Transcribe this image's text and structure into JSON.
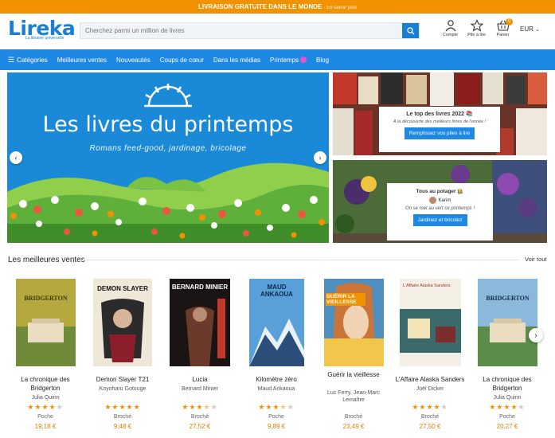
{
  "topbar": {
    "main": "LIVRAISON GRATUITE DANS LE MONDE",
    "more": "- En savoir plus"
  },
  "logo": {
    "brand": "Lireka",
    "tagline": "La librairie universelle"
  },
  "search": {
    "placeholder": "Cherchez parmi un million de livres"
  },
  "header_icons": [
    {
      "label": "Compte",
      "icon": "user-icon"
    },
    {
      "label": "Pile à lire",
      "icon": "star-icon"
    },
    {
      "label": "Panier",
      "icon": "basket-icon",
      "badge": "0"
    }
  ],
  "currency": "EUR",
  "nav": [
    "Catégories",
    "Meilleures ventes",
    "Nouveautés",
    "Coups de cœur",
    "Dans les médias",
    "Printemps",
    "Blog"
  ],
  "hero": {
    "title": "Les livres du printemps",
    "subtitle": "Romans feed-good, jardinage, bricolage"
  },
  "promo1": {
    "title": "Le top des livres 2022 📚",
    "text": "À la découverte des meilleurs livres de l'année !",
    "button": "Remplissez vos piles à lire"
  },
  "promo2": {
    "title": "Tous au potager 👩‍🌾",
    "author": "Karim",
    "text": "On se met au vert ce printemps !",
    "button": "Jardinez et bricolez"
  },
  "section": {
    "title": "Les meilleures ventes",
    "see_all": "Voir tout"
  },
  "books": [
    {
      "title": "La chronique des Bridgerton",
      "author": "Julia Quinn",
      "rating": 4,
      "format": "Poche",
      "price": "19,18 €",
      "cover_text": "BRIDGERTON"
    },
    {
      "title": "Demon Slayer T21",
      "author": "Koyoharu Gotouge",
      "rating": 5,
      "format": "Broché",
      "price": "9,48 €",
      "cover_text": "DEMON SLAYER"
    },
    {
      "title": "Lucia",
      "author": "Bernard Minier",
      "rating": 3.5,
      "format": "Broché",
      "price": "27,52 €",
      "cover_text": "BERNARD MINIER"
    },
    {
      "title": "Kilomètre zéro",
      "author": "Maud Ankaoua",
      "rating": 3.5,
      "format": "Poche",
      "price": "9,89 €",
      "cover_text": "MAUD ANKAOUA"
    },
    {
      "title": "Guérir la vieillesse",
      "author": "Luc Ferry, Jean-Marc Lemaître",
      "rating": 0,
      "format": "Broché",
      "price": "23,49 €",
      "cover_text": "GUÉRIR LA VIEILLESSE"
    },
    {
      "title": "L'Affaire Alaska Sanders",
      "author": "Joël Dicker",
      "rating": 4,
      "format": "Broché",
      "price": "27,50 €",
      "cover_text": "L'Affaire Alaska Sanders"
    },
    {
      "title": "La chronique des Bridgerton",
      "author": "Julia Quinn",
      "rating": 4,
      "format": "Poche",
      "price": "20,27 €",
      "cover_text": "BRIDGERTON"
    }
  ],
  "colors": {
    "accent": "#f39200",
    "brand": "#1e88e5"
  }
}
